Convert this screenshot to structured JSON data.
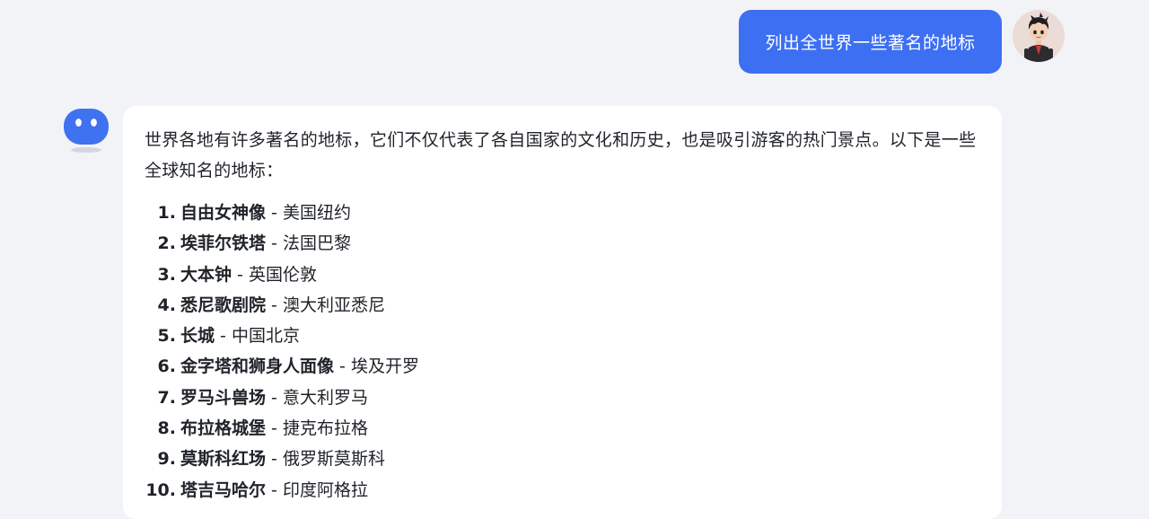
{
  "user_message": {
    "text": "列出全世界一些著名的地标"
  },
  "bot_message": {
    "intro": "世界各地有许多著名的地标，它们不仅代表了各自国家的文化和历史，也是吸引游客的热门景点。以下是一些全球知名的地标：",
    "separator": " - ",
    "landmarks": [
      {
        "num": "1.",
        "name": "自由女神像",
        "location": "美国纽约"
      },
      {
        "num": "2.",
        "name": "埃菲尔铁塔",
        "location": "法国巴黎"
      },
      {
        "num": "3.",
        "name": "大本钟",
        "location": "英国伦敦"
      },
      {
        "num": "4.",
        "name": "悉尼歌剧院",
        "location": "澳大利亚悉尼"
      },
      {
        "num": "5.",
        "name": "长城",
        "location": "中国北京"
      },
      {
        "num": "6.",
        "name": "金字塔和狮身人面像",
        "location": "埃及开罗"
      },
      {
        "num": "7.",
        "name": "罗马斗兽场",
        "location": "意大利罗马"
      },
      {
        "num": "8.",
        "name": "布拉格城堡",
        "location": "捷克布拉格"
      },
      {
        "num": "9.",
        "name": "莫斯科红场",
        "location": "俄罗斯莫斯科"
      },
      {
        "num": "10.",
        "name": "塔吉马哈尔",
        "location": "印度阿格拉"
      }
    ]
  },
  "colors": {
    "background": "#f2f3f7",
    "user_bubble": "#3d6ff2",
    "bot_bubble": "#ffffff",
    "bot_avatar": "#3f72f0",
    "text": "#1f2329"
  },
  "icons": {
    "user_avatar": "cartoon-boy-avatar",
    "bot_avatar": "blue-robot-avatar"
  }
}
